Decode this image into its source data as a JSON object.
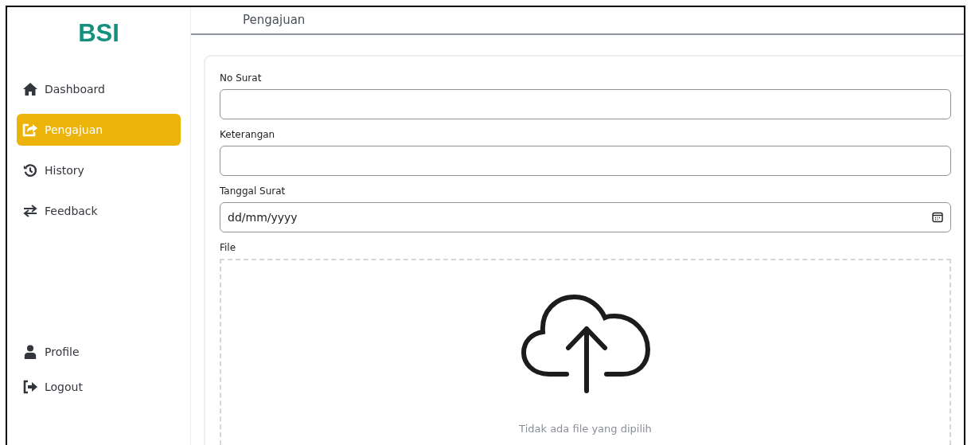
{
  "logo": "BSI",
  "nav": [
    {
      "label": "Dashboard",
      "selected": false
    },
    {
      "label": "Pengajuan",
      "selected": true
    },
    {
      "label": "History",
      "selected": false
    },
    {
      "label": "Feedback",
      "selected": false
    }
  ],
  "nav_bottom": [
    {
      "label": "Profile",
      "selected": false
    },
    {
      "label": "Logout",
      "selected": false
    }
  ],
  "header": {
    "title": "Pengajuan"
  },
  "form": {
    "fields": [
      {
        "label": "No Surat",
        "kind": "text"
      },
      {
        "label": "Keterangan",
        "kind": "text"
      },
      {
        "label": "Tanggal Surat",
        "kind": "date",
        "placeholder": "dd/mm/yyyy"
      }
    ],
    "file": {
      "label": "File",
      "status": "Tidak ada file yang dipilih"
    }
  }
}
